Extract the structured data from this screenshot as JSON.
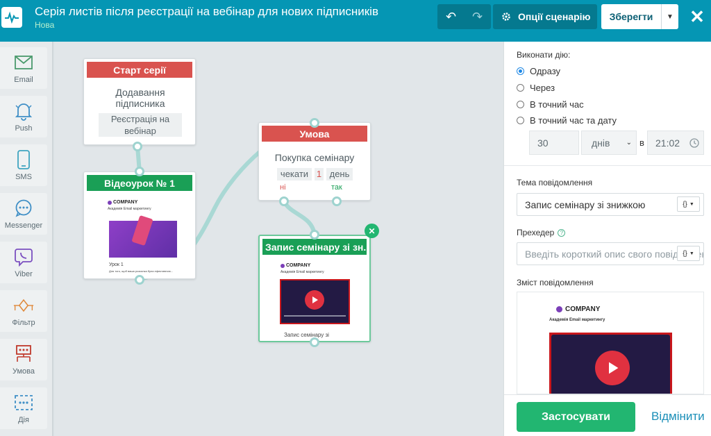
{
  "header": {
    "title": "Серія листів після реєстрації на вебінар для нових підписників",
    "status": "Нова",
    "options_label": "Опції сценарію",
    "save_label": "Зберегти"
  },
  "toolbox": {
    "items": [
      {
        "label": "Email",
        "icon": "envelope-icon"
      },
      {
        "label": "Push",
        "icon": "bell-icon"
      },
      {
        "label": "SMS",
        "icon": "phone-icon"
      },
      {
        "label": "Messenger",
        "icon": "chat-icon"
      },
      {
        "label": "Viber",
        "icon": "viber-icon"
      },
      {
        "label": "Фільтр",
        "icon": "filter-icon"
      },
      {
        "label": "Умова",
        "icon": "condition-icon"
      },
      {
        "label": "Дія",
        "icon": "action-icon"
      }
    ]
  },
  "canvas": {
    "start_node": {
      "header": "Старт серії",
      "title": "Додавання підписника",
      "chip": "Реєстрація на вебінар"
    },
    "lesson_node": {
      "header": "Відеоурок № 1",
      "thumb_company": "COMPANY",
      "thumb_subtitle": "Академія Email маркетингу",
      "thumb_lesson": "Урок 1",
      "thumb_text": "Для того, щоб ваша розсилка була ефективною..."
    },
    "condition_node": {
      "header": "Умова",
      "title": "Покупка семінару",
      "wait_label": "чекати",
      "wait_value": "1",
      "wait_unit": "день",
      "no_label": "ні",
      "yes_label": "так"
    },
    "seminar_node": {
      "header": "Запис семінару зі зн...",
      "thumb_company": "COMPANY",
      "thumb_subtitle": "Академія Email маркетингу",
      "caption": "Запис семінару зі"
    }
  },
  "panel": {
    "action_label": "Виконати дію:",
    "options": [
      "Одразу",
      "Через",
      "В точний час",
      "В точний час та дату"
    ],
    "selected": 0,
    "delay_value": "30",
    "delay_unit": "днів",
    "in_label": "в",
    "time_value": "21:02",
    "subject_label": "Тема повідомлення",
    "subject_value": "Запис семінару зі знижкою",
    "preheader_label": "Прехедер",
    "preheader_placeholder": "Введіть короткий опис свого повідомлення",
    "content_label": "Зміст повідомлення",
    "preview_company": "COMPANY",
    "preview_subtitle": "Академія Email маркетингу",
    "apply_label": "Застосувати",
    "cancel_label": "Відмінити"
  },
  "colors": {
    "header": "#0596b4",
    "accent_green": "#22b671",
    "node_red": "#d9534f",
    "node_green": "#1a9f56",
    "link": "#1b8fb8"
  }
}
